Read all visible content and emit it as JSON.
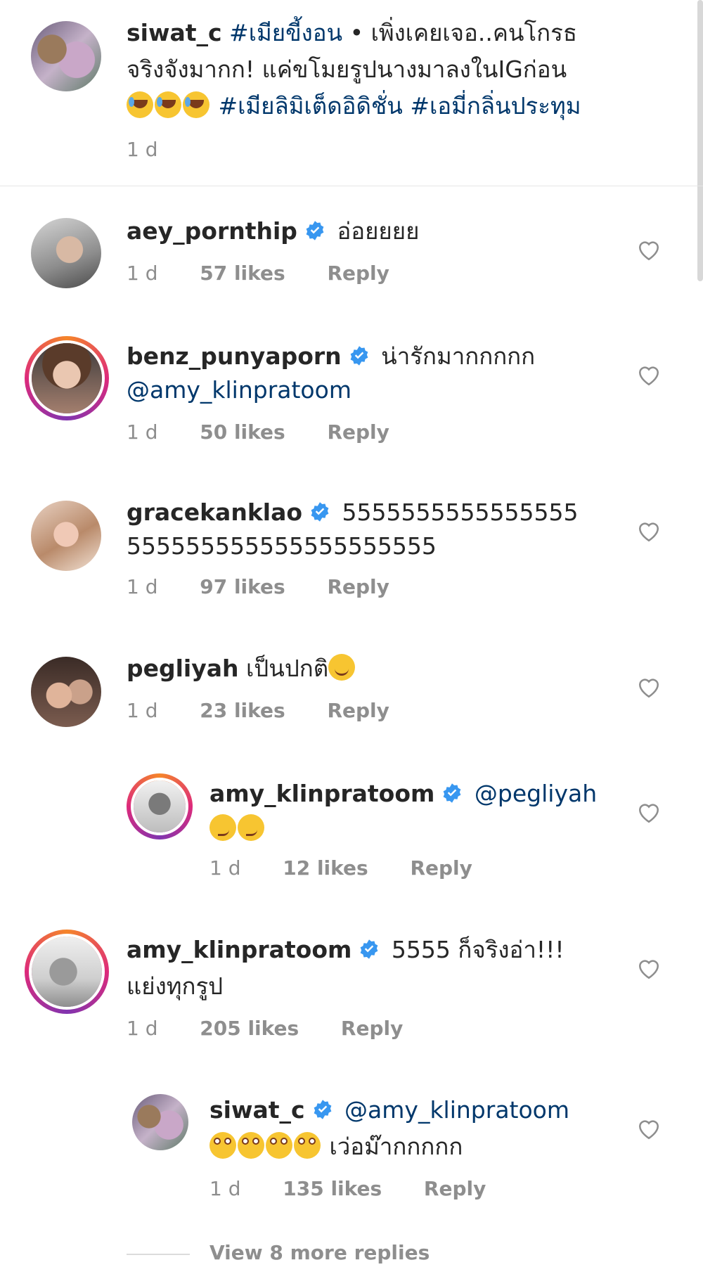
{
  "caption": {
    "username": "siwat_c",
    "line1_tag": "#เมียขี้งอน",
    "line1_text": " • เพิ่งเคยเจอ..คนโกรธ",
    "line2_text": "จริงจังมากก! แค่ขโมยรูปนางมาลงในIGก่อน",
    "line3_tags": " #เมียลิมิเต็ดอิดิชั่น #เอมี่กลิ่นประทุม",
    "time": "1 d"
  },
  "comments": [
    {
      "username": "aey_pornthip",
      "text1": "อ่อยยยย",
      "text2": "",
      "time": "1 d",
      "likes": "57 likes",
      "reply": "Reply"
    },
    {
      "username": "benz_punyaporn",
      "text1": "น่ารักมากกกกก",
      "mention": "@amy_klinpratoom",
      "time": "1 d",
      "likes": "50 likes",
      "reply": "Reply"
    },
    {
      "username": "gracekanklao",
      "text1": "5555555555555555",
      "text2": "555555555555555555555",
      "time": "1 d",
      "likes": "97 likes",
      "reply": "Reply"
    },
    {
      "username": "pegliyah",
      "text1": "เป็นปกติ",
      "time": "1 d",
      "likes": "23 likes",
      "reply": "Reply"
    },
    {
      "username": "amy_klinpratoom",
      "mention": "@pegliyah",
      "time": "1 d",
      "likes": "12 likes",
      "reply": "Reply"
    },
    {
      "username": "amy_klinpratoom",
      "text1": "5555 ก็จริงอ่า!!!",
      "text2": "แย่งทุกรูป",
      "time": "1 d",
      "likes": "205 likes",
      "reply": "Reply"
    },
    {
      "username": "siwat_c",
      "mention": "@amy_klinpratoom",
      "text2": " เว่อม๊ากกกกก",
      "time": "1 d",
      "likes": "135 likes",
      "reply": "Reply"
    }
  ],
  "view_more": "View 8 more replies",
  "colors": {
    "link": "#00376b",
    "meta": "#8e8e8e",
    "verified": "#3897f0"
  }
}
